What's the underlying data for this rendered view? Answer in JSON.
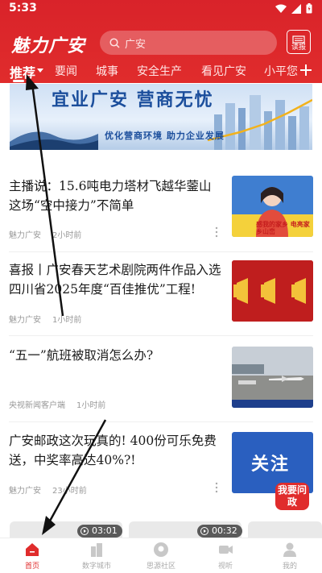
{
  "status": {
    "time": "5:33"
  },
  "header": {
    "logo": "魅力广安",
    "search_placeholder": "广安",
    "report_label": "读报"
  },
  "tabs": [
    {
      "label": "推荐",
      "active": true
    },
    {
      "label": "要闻"
    },
    {
      "label": "城事"
    },
    {
      "label": "安全生产"
    },
    {
      "label": "看见广安"
    },
    {
      "label": "小平您"
    }
  ],
  "banner": {
    "title": "宜业广安 营商无忧",
    "subtitle": "优化营商环境 助力企业发展"
  },
  "news": [
    {
      "title": "主播说：15.6吨电力塔材飞越华蓥山 这场“空中接力”不简单",
      "source": "魅力广安",
      "time": "2小时前",
      "thumb_caption": "感我的家乡 电亮家乡山峦"
    },
    {
      "title": "喜报丨广安春天艺术剧院两件作品入选四川省2025年度“百佳推优”工程!",
      "source": "魅力广安",
      "time": "1小时前"
    },
    {
      "title": "“五一”航班被取消怎么办?",
      "source": "央视新闻客户端",
      "time": "1小时前"
    },
    {
      "title": "广安邮政这次玩真的! 400份可乐免费送，中奖率高达40%?!",
      "source": "魅力广安",
      "time": "23小时前",
      "thumb_caption": "关注"
    }
  ],
  "ask_button": "我要问政",
  "videos": [
    {
      "duration": "03:01"
    },
    {
      "duration": "00:32"
    }
  ],
  "bottom_nav": [
    {
      "label": "首页",
      "active": true
    },
    {
      "label": "数字城市"
    },
    {
      "label": "思源社区"
    },
    {
      "label": "视听"
    },
    {
      "label": "我的"
    }
  ],
  "colors": {
    "brand": "#e02c2c",
    "banner_blue": "#1b4e9c"
  }
}
